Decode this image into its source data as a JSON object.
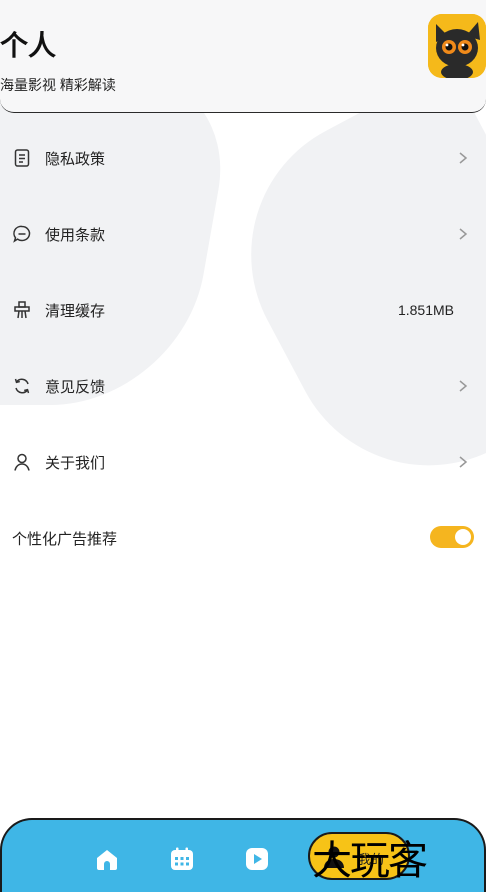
{
  "header": {
    "title": "个人",
    "subtitle": "海量影视 精彩解读"
  },
  "menu": {
    "privacy": {
      "label": "隐私政策"
    },
    "terms": {
      "label": "使用条款"
    },
    "cache": {
      "label": "清理缓存",
      "value": "1.851MB"
    },
    "feedback": {
      "label": "意见反馈"
    },
    "about": {
      "label": "关于我们"
    }
  },
  "ad_toggle": {
    "label": "个性化广告推荐",
    "on": true
  },
  "tabbar": {
    "tabs": [
      "home-icon",
      "calendar-icon",
      "play-icon",
      "person-icon"
    ],
    "active_label": "我的"
  },
  "watermark": {
    "text": "大玩客"
  },
  "colors": {
    "accent": "#f5b51f",
    "tabbar": "#3fb6e6"
  }
}
